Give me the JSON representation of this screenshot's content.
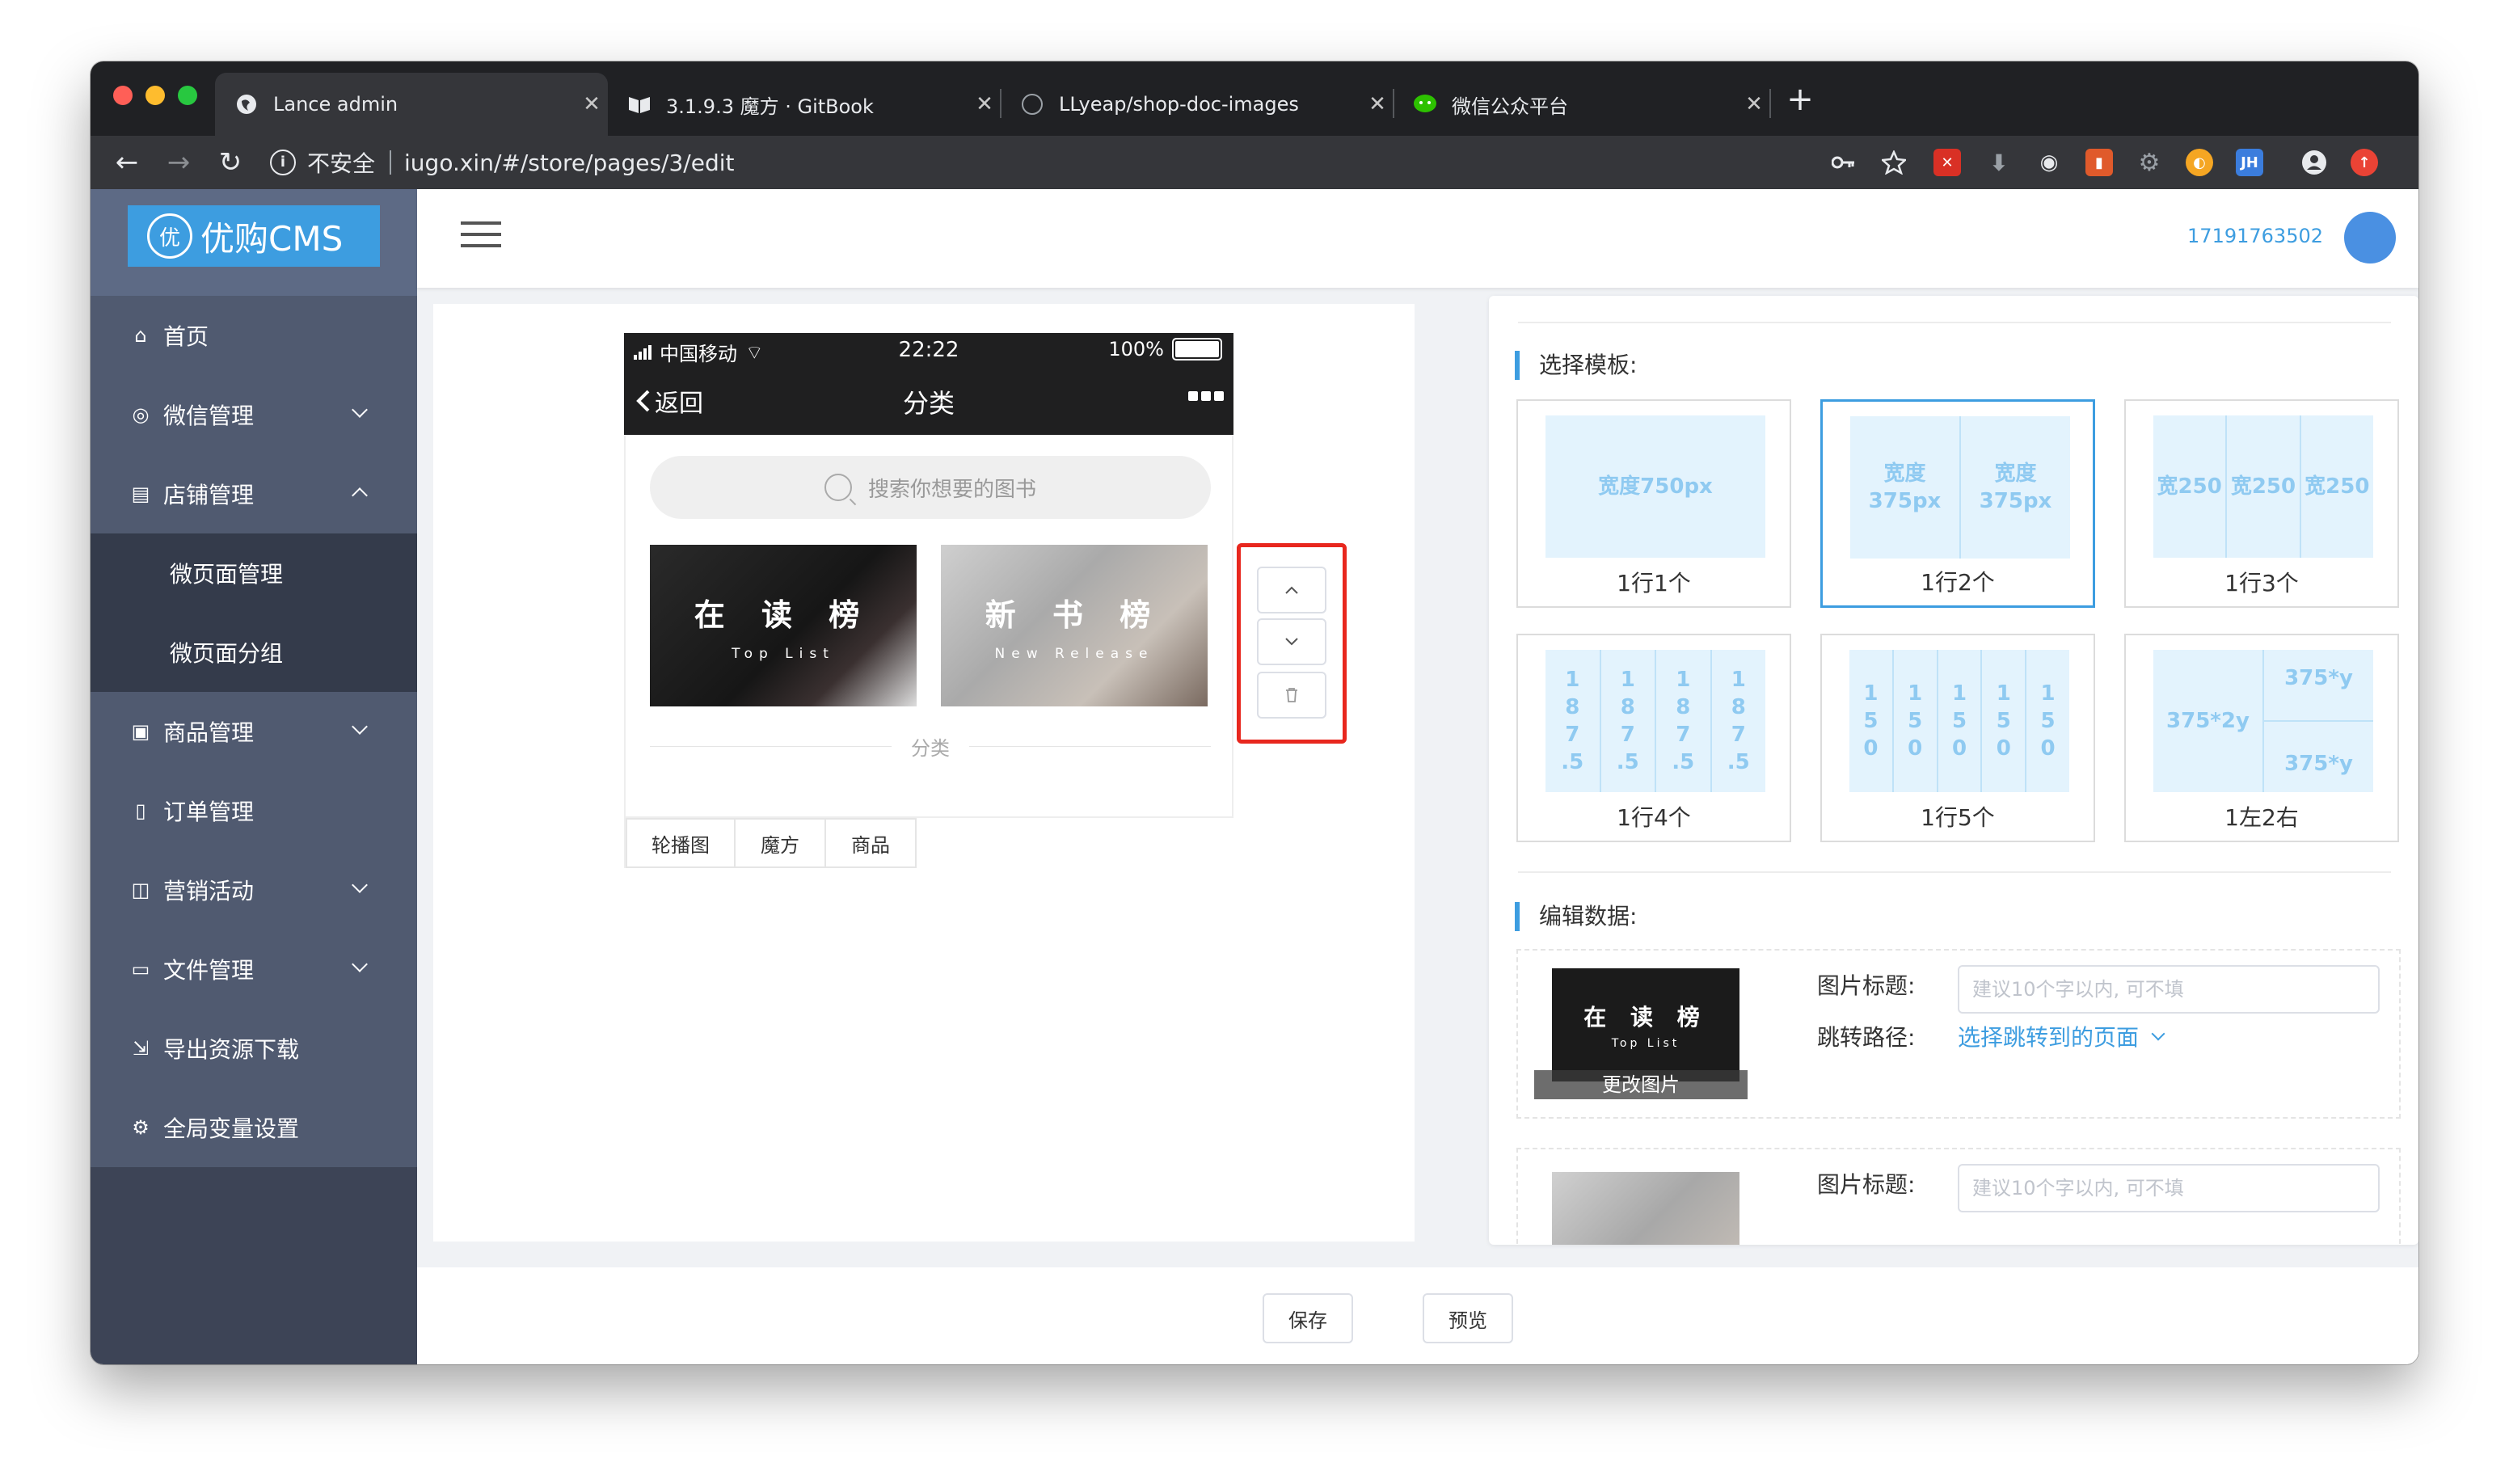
{
  "browser": {
    "tabs": [
      {
        "title": "Lance admin",
        "close": "✕"
      },
      {
        "title": "3.1.9.3 魔方 · GitBook",
        "close": "✕"
      },
      {
        "title": "LLyeap/shop-doc-images",
        "close": "✕"
      },
      {
        "title": "微信公众平台",
        "close": "✕"
      }
    ],
    "new_tab": "+",
    "back": "←",
    "forward": "→",
    "reload": "↻",
    "security_label": "不安全",
    "url": "iugo.xin/#/store/pages/3/edit",
    "ext_labels": {
      "jh": "JH"
    }
  },
  "logo": {
    "mark": "优",
    "text": "优购CMS"
  },
  "sidebar": {
    "items": [
      {
        "icon": "⌂",
        "label": "首页"
      },
      {
        "icon": "◎",
        "label": "微信管理"
      },
      {
        "icon": "▤",
        "label": "店铺管理"
      },
      {
        "icon": "",
        "label": "微页面管理"
      },
      {
        "icon": "",
        "label": "微页面分组"
      },
      {
        "icon": "▣",
        "label": "商品管理"
      },
      {
        "icon": "▯",
        "label": "订单管理"
      },
      {
        "icon": "◫",
        "label": "营销活动"
      },
      {
        "icon": "▭",
        "label": "文件管理"
      },
      {
        "icon": "⇲",
        "label": "导出资源下载"
      },
      {
        "icon": "⚙",
        "label": "全局变量设置"
      }
    ]
  },
  "header": {
    "user_id": "17191763502"
  },
  "phone": {
    "carrier": "中国移动",
    "wifi": "⌔",
    "time": "22:22",
    "battery": "100%",
    "back_label": "返回",
    "title": "分类",
    "search_placeholder": "搜索你想要的图书",
    "images": [
      {
        "title": "在 读 榜",
        "subtitle": "Top List"
      },
      {
        "title": "新 书 榜",
        "subtitle": "New Release"
      }
    ],
    "divider": "分类",
    "bottom_tabs": [
      "轮播图",
      "魔方",
      "商品"
    ]
  },
  "controls": {
    "up": "⌃",
    "down": "⌄",
    "delete": "🗑"
  },
  "editor": {
    "template_title": "选择模板:",
    "templates": [
      {
        "cols": [
          "宽度750px"
        ],
        "label": "1行1个"
      },
      {
        "cols": [
          "宽度\n375px",
          "宽度\n375px"
        ],
        "label": "1行2个"
      },
      {
        "cols": [
          "宽250",
          "宽250",
          "宽250"
        ],
        "label": "1行3个"
      },
      {
        "cols": [
          "1\n8\n7\n.5",
          "1\n8\n7\n.5",
          "1\n8\n7\n.5",
          "1\n8\n7\n.5"
        ],
        "label": "1行4个"
      },
      {
        "cols": [
          "1\n5\n0",
          "1\n5\n0",
          "1\n5\n0",
          "1\n5\n0",
          "1\n5\n0"
        ],
        "label": "1行5个"
      },
      {
        "left": "375*2y",
        "right_top": "375*y",
        "right_bottom": "375*y",
        "label": "1左2右"
      }
    ],
    "data_title": "编辑数据:",
    "entries": [
      {
        "thumb_title": "在 读 榜",
        "thumb_sub": "Top List",
        "change_label": "更改图片",
        "title_label": "图片标题:",
        "title_placeholder": "建议10个字以内, 可不填",
        "path_label": "跳转路径:",
        "path_value": "选择跳转到的页面"
      },
      {
        "title_label": "图片标题:",
        "title_placeholder": "建议10个字以内, 可不填"
      }
    ]
  },
  "footer": {
    "save": "保存",
    "preview": "预览"
  },
  "colors": {
    "accent": "#3d9de0",
    "highlight": "#e8271e",
    "sidebar": "#505a70"
  }
}
